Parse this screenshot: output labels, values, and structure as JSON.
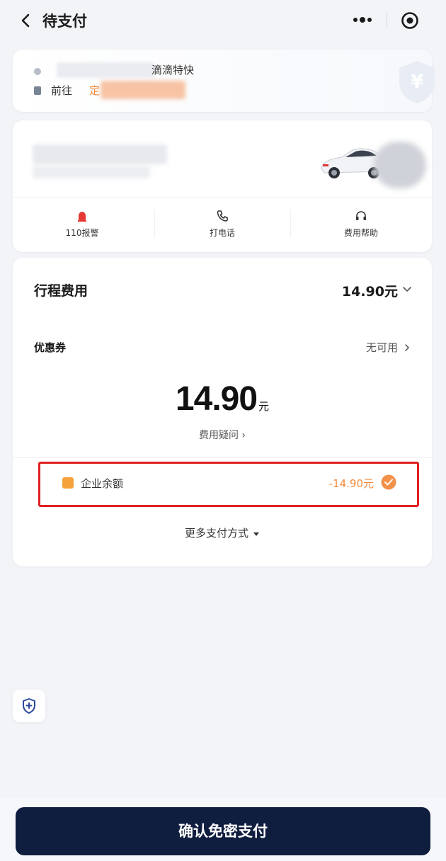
{
  "header": {
    "title": "待支付",
    "icons": [
      "back-arrow",
      "more-dots",
      "target-circle"
    ]
  },
  "route": {
    "start_suffix": "滴滴特快",
    "dest_label": "前往",
    "dest_highlight": "定"
  },
  "driver_actions": [
    {
      "label": "110报警",
      "icon": "alarm-icon"
    },
    {
      "label": "打电话",
      "icon": "phone-icon"
    },
    {
      "label": "费用帮助",
      "icon": "headset-icon"
    }
  ],
  "fee": {
    "title": "行程费用",
    "amount": "14.90元",
    "coupon_label": "优惠券",
    "coupon_value": "无可用",
    "total": "14.90",
    "total_unit": "元",
    "question": "费用疑问 ›"
  },
  "payment": {
    "method": "企业余额",
    "amount": "-14.90元",
    "selected": true
  },
  "more_payment": "更多支付方式",
  "confirm_button": "确认免密支付",
  "colors": {
    "primary_button": "#0f1d3f",
    "accent_orange": "#f28a3c",
    "highlight_red": "#e02020",
    "background": "#f2f4f8"
  }
}
